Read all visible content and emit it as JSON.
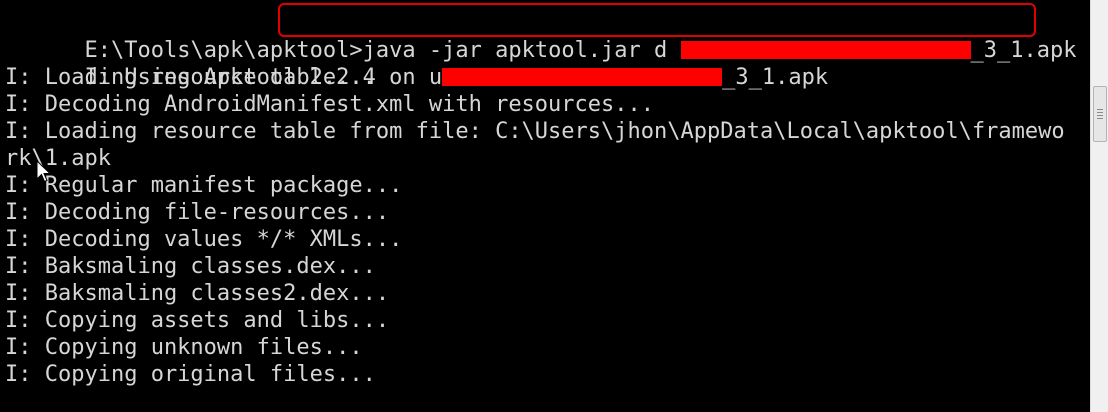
{
  "console": {
    "prompt": "E:\\Tools\\apk\\apktool>",
    "command_prefix": "java -jar apktool.jar d ",
    "command_suffix": "_3_1.apk",
    "line1_prefix": "I: Using Apktool 2.2.4 on u",
    "line1_suffix": "_3_1.apk",
    "lines": [
      "I: Loading resource table...",
      "I: Decoding AndroidManifest.xml with resources...",
      "I: Loading resource table from file: C:\\Users\\jhon\\AppData\\Local\\apktool\\framewo",
      "rk\\1.apk",
      "I: Regular manifest package...",
      "I: Decoding file-resources...",
      "I: Decoding values */* XMLs...",
      "I: Baksmaling classes.dex...",
      "I: Baksmaling classes2.dex...",
      "I: Copying assets and libs...",
      "I: Copying unknown files...",
      "I: Copying original files..."
    ]
  },
  "colors": {
    "background": "#000000",
    "text": "#d6d6d6",
    "highlight": "#e00000",
    "redaction": "#ff0000"
  }
}
